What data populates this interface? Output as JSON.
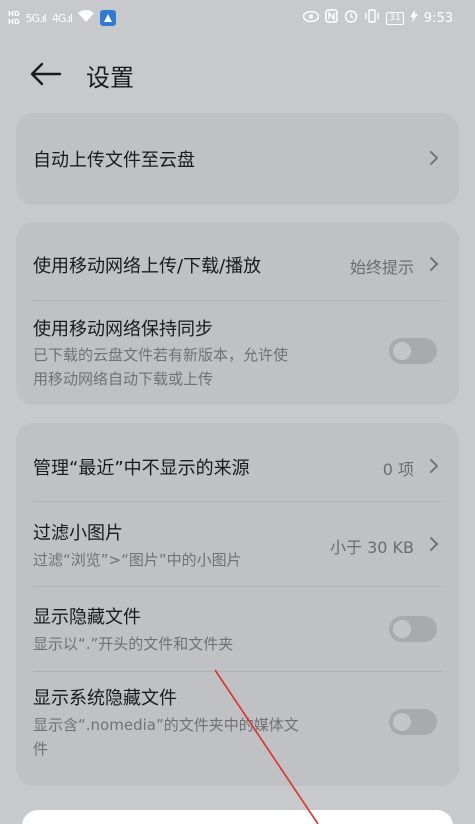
{
  "status_bar": {
    "hd_top": "HD",
    "hd_bottom": "HD",
    "signal": "5G.ıl",
    "signal2": "4G.ıl",
    "battery": "31",
    "time": "9:53",
    "icons": [
      "eye-icon",
      "nfc-icon",
      "alarm-icon",
      "vibrate-icon",
      "battery-icon",
      "charging-icon"
    ]
  },
  "header": {
    "back_icon": "arrow-left-icon",
    "title": "设置"
  },
  "sections": {
    "upload": {
      "label": "自动上传文件至云盘"
    },
    "mobile_upload": {
      "label": "使用移动网络上传/下载/播放",
      "value": "始终提示"
    },
    "mobile_sync": {
      "label": "使用移动网络保持同步",
      "desc_line1": "已下载的云盘文件若有新版本，允许使",
      "desc_line2": "用移动网络自动下载或上传",
      "enabled": false
    },
    "recent_sources": {
      "label": "管理“最近”中不显示的来源",
      "value": "0 项"
    },
    "filter_small": {
      "label": "过滤小图片",
      "desc": "过滤“浏览”>“图片”中的小图片",
      "value": "小于 30 KB"
    },
    "show_hidden": {
      "label": "显示隐藏文件",
      "desc": "显示以“.”开头的文件和文件夹",
      "enabled": false
    },
    "show_system_hidden": {
      "label": "显示系统隐藏文件",
      "desc_line1": "显示含“.nomedia”的文件夹中的媒体文",
      "desc_line2": "件",
      "enabled": false
    }
  },
  "colors": {
    "background": "#c8c9cc",
    "card": "#c0c1c4",
    "annotation_arrow": "#e0302a"
  }
}
